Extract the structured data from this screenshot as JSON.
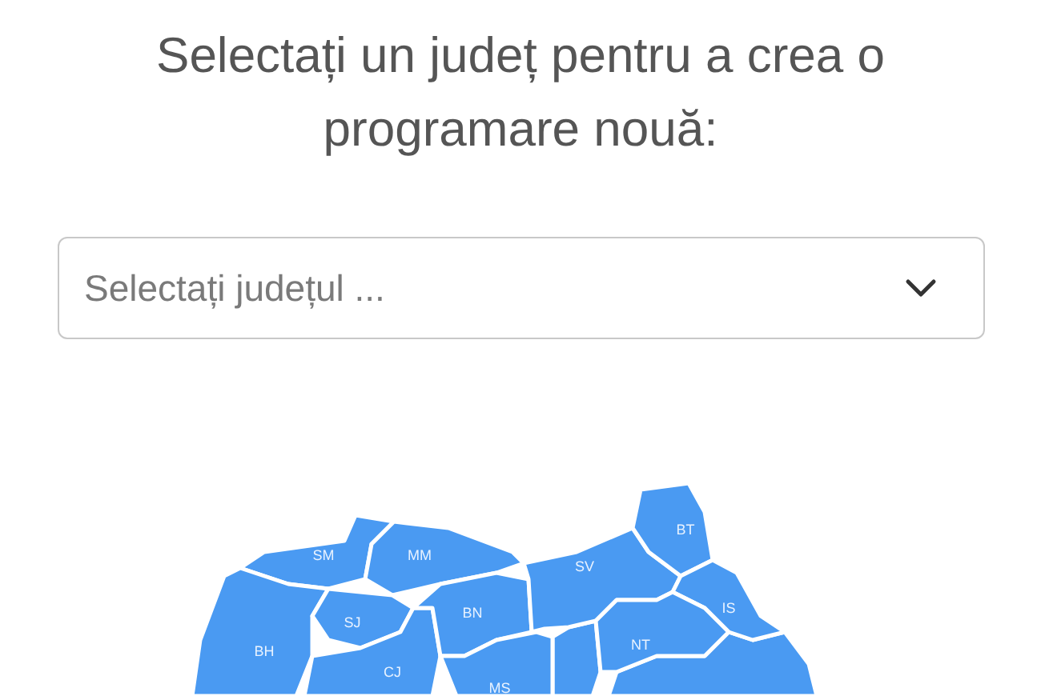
{
  "title": "Selectați un județ pentru a crea o programare nouă:",
  "county_select": {
    "placeholder": "Selectați județul ..."
  },
  "map": {
    "counties": [
      {
        "code": "SM"
      },
      {
        "code": "MM"
      },
      {
        "code": "BH"
      },
      {
        "code": "SJ"
      },
      {
        "code": "CJ"
      },
      {
        "code": "BN"
      },
      {
        "code": "MS"
      },
      {
        "code": "SV"
      },
      {
        "code": "BT"
      },
      {
        "code": "IS"
      },
      {
        "code": "NT"
      }
    ]
  }
}
